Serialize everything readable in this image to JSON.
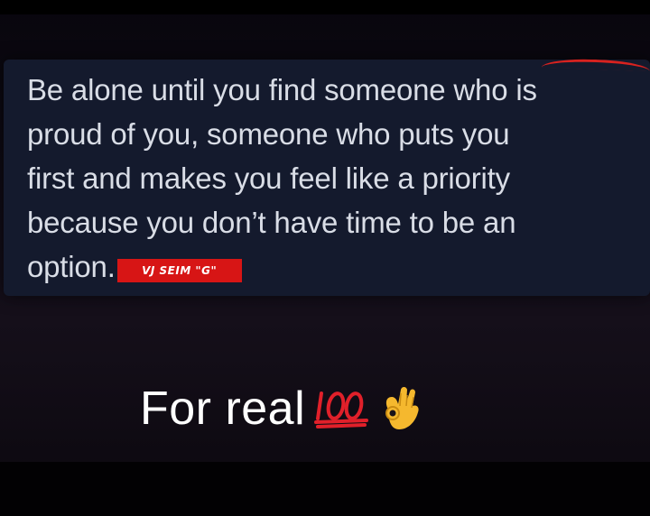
{
  "post": {
    "quote_lines": [
      "Be alone until you find someone who is",
      "proud of you, someone who puts you",
      "first and makes you feel like a priority",
      "because you don’t have time to be an",
      "option."
    ],
    "tag_badge": "VJ SEIM \"G\"",
    "tag_badge_color": "#d71515",
    "caption": "For real",
    "caption_emojis": [
      "hundred-points-icon",
      "ok-hand-icon"
    ]
  },
  "colors": {
    "card_background": "#141a2d",
    "quote_text": "#d9dde6",
    "caption_text": "#ffffff",
    "accent_red": "#d8221f"
  }
}
